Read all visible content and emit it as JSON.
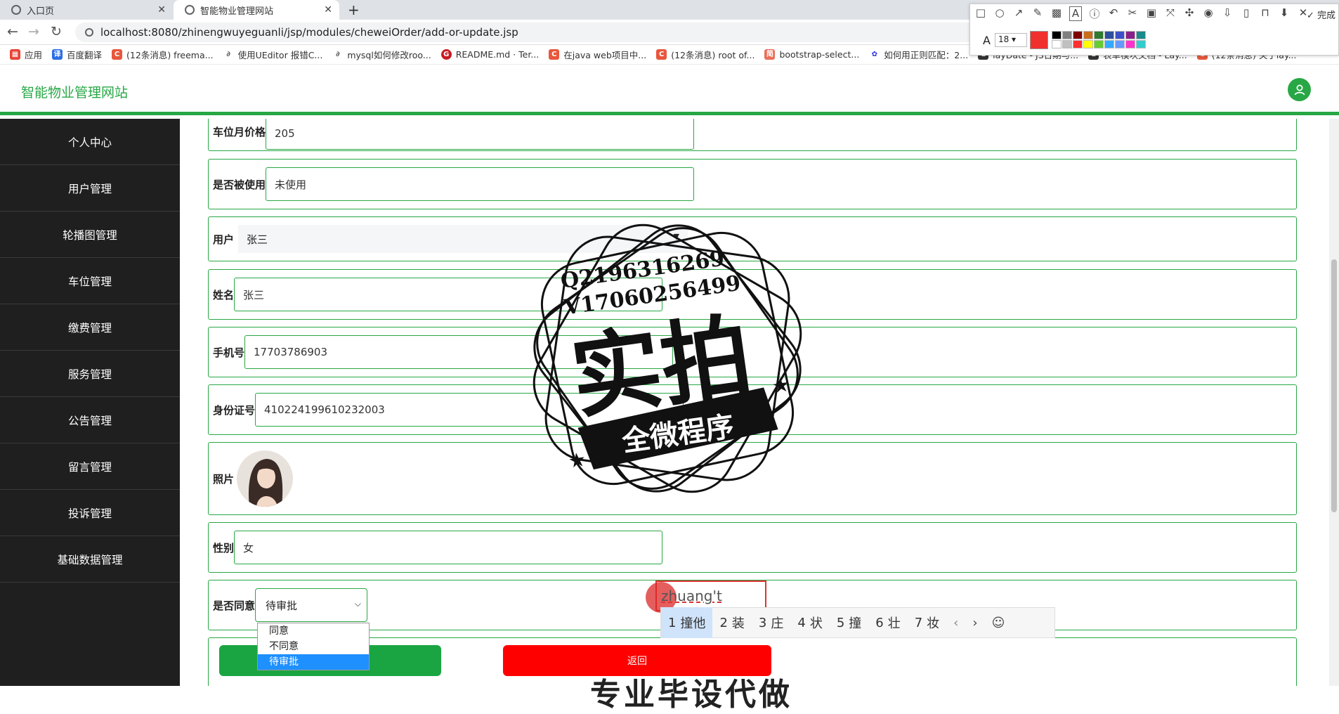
{
  "browser": {
    "tabs": [
      {
        "label": "入口页"
      },
      {
        "label": "智能物业管理网站"
      }
    ],
    "url": "localhost:8080/zhinengwuyeguanli/jsp/modules/cheweiOrder/add-or-update.jsp",
    "bookmarks": [
      {
        "label": "应用",
        "icon": "apps-grid-icon",
        "color": "#e94235"
      },
      {
        "label": "百度翻译",
        "icon": "translate-icon",
        "color": "#2b6de5"
      },
      {
        "label": "(12条消息) freema...",
        "icon": "csdn-icon",
        "color": "#e8573c"
      },
      {
        "label": "使用UEditor 报错C...",
        "icon": "scheme-icon",
        "color": "#555555"
      },
      {
        "label": "mysql如何修改roo...",
        "icon": "scheme-icon",
        "color": "#555555"
      },
      {
        "label": "README.md · Ter...",
        "icon": "gitee-icon",
        "color": "#c71d23"
      },
      {
        "label": "在java web项目中...",
        "icon": "csdn-icon",
        "color": "#e8573c"
      },
      {
        "label": "(12条消息) root of...",
        "icon": "csdn-icon",
        "color": "#e8573c"
      },
      {
        "label": "bootstrap-select...",
        "icon": "jianshu-icon",
        "color": "#ea6f5a"
      },
      {
        "label": "如何用正则匹配：2...",
        "icon": "baidu-icon",
        "color": "#2932e1"
      },
      {
        "label": "layDate - JS日期与...",
        "icon": "layui-icon",
        "color": "#333333"
      },
      {
        "label": "表单模块文档 - Lay...",
        "icon": "layui-icon",
        "color": "#333333"
      },
      {
        "label": "(12条消息) 关于lay...",
        "icon": "csdn-icon",
        "color": "#e8573c"
      }
    ]
  },
  "screenshot_tool": {
    "done_label": "完成",
    "font_size": "18",
    "active_color": "#f0302d",
    "palette": [
      "#000000",
      "#808080",
      "#800000",
      "#c96d1a",
      "#2f7a2f",
      "#2d4f9e",
      "#3c4fc9",
      "#8a1f8a",
      "#1a8a8a",
      "#ffffff",
      "#c0c0c0",
      "#ff3030",
      "#ffff00",
      "#66cc33",
      "#33aaff",
      "#6699ff",
      "#ff33cc",
      "#33cccc"
    ]
  },
  "header": {
    "title": "智能物业管理网站",
    "accent": "#28a745"
  },
  "sidebar": {
    "items": [
      {
        "label": "个人中心"
      },
      {
        "label": "用户管理"
      },
      {
        "label": "轮播图管理"
      },
      {
        "label": "车位管理"
      },
      {
        "label": "缴费管理"
      },
      {
        "label": "服务管理"
      },
      {
        "label": "公告管理"
      },
      {
        "label": "留言管理"
      },
      {
        "label": "投诉管理"
      },
      {
        "label": "基础数据管理"
      }
    ]
  },
  "form": {
    "price": {
      "label": "车位月价格",
      "value": "205"
    },
    "used": {
      "label": "是否被使用",
      "value": "未使用"
    },
    "user": {
      "label": "用户",
      "value": "张三"
    },
    "name": {
      "label": "姓名",
      "value": "张三"
    },
    "phone": {
      "label": "手机号",
      "value": "17703786903"
    },
    "idcard": {
      "label": "身份证号",
      "value": "410224199610232003"
    },
    "photo": {
      "label": "照片"
    },
    "gender": {
      "label": "性别",
      "value": "女"
    },
    "status": {
      "label": "是否同意",
      "value": "待审批",
      "options": [
        "同意",
        "不同意",
        "待审批"
      ]
    },
    "submit": {
      "label": "",
      "color": "#1aa542"
    },
    "back": {
      "label": "返回",
      "color": "#ff0000"
    }
  },
  "ime": {
    "composition": "zhuang't",
    "candidates": [
      {
        "n": "1",
        "text": "撞他"
      },
      {
        "n": "2",
        "text": "装"
      },
      {
        "n": "3",
        "text": "庄"
      },
      {
        "n": "4",
        "text": "状"
      },
      {
        "n": "5",
        "text": "撞"
      },
      {
        "n": "6",
        "text": "壮"
      },
      {
        "n": "7",
        "text": "妆"
      }
    ]
  },
  "watermark": {
    "line1": "Q2196316269",
    "line2": "V17060256499",
    "big": "实拍",
    "banner": "全微程序",
    "bottom": "专业毕设代做"
  }
}
